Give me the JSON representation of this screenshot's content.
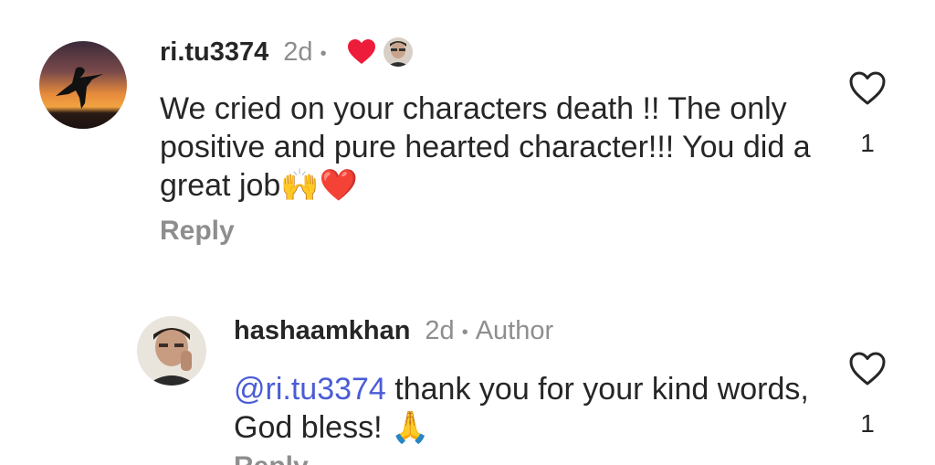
{
  "comments": [
    {
      "username": "ri.tu3374",
      "time": "2d",
      "separator": "•",
      "text_line1": "We cried on your characters death !! The only positive and pure hearted character!!! You did a great job",
      "emojis": "🙌❤️",
      "reply_label": "Reply",
      "like_count": "1",
      "liked_by_author": true,
      "heart_color": "#ed1c3a"
    },
    {
      "username": "hashaamkhan",
      "time": "2d",
      "separator": "•",
      "badge": "Author",
      "mention": "@ri.tu3374",
      "text": " thank you for your kind words, God bless! ",
      "emoji": "🙏",
      "reply_label": "Reply",
      "like_count": "1"
    }
  ],
  "colors": {
    "text_primary": "#262626",
    "text_secondary": "#8e8e8e",
    "mention": "#4a5cd6"
  }
}
